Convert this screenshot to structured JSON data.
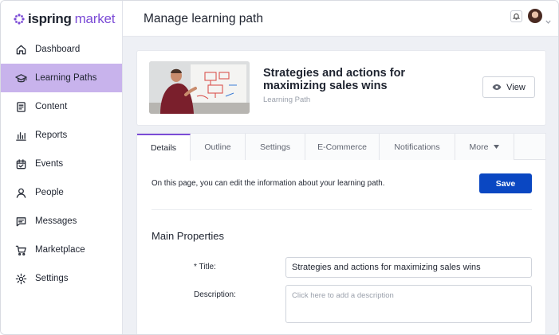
{
  "brand": {
    "name_bold": "ispring",
    "name_light": "market",
    "accent": "#7b4bd6",
    "icon": "flower-icon"
  },
  "sidebar": {
    "items": [
      {
        "label": "Dashboard",
        "icon": "home-icon",
        "active": false
      },
      {
        "label": "Learning Paths",
        "icon": "graduation-cap-icon",
        "active": true
      },
      {
        "label": "Content",
        "icon": "document-icon",
        "active": false
      },
      {
        "label": "Reports",
        "icon": "bar-chart-icon",
        "active": false
      },
      {
        "label": "Events",
        "icon": "calendar-check-icon",
        "active": false
      },
      {
        "label": "People",
        "icon": "person-icon",
        "active": false
      },
      {
        "label": "Messages",
        "icon": "message-icon",
        "active": false
      },
      {
        "label": "Marketplace",
        "icon": "cart-icon",
        "active": false
      },
      {
        "label": "Settings",
        "icon": "gear-icon",
        "active": false
      }
    ]
  },
  "header": {
    "title": "Manage learning path",
    "bell_icon": "bell-icon",
    "avatar": "user-avatar"
  },
  "course": {
    "title": "Strategies and actions for maximizing sales wins",
    "type": "Learning Path",
    "view_label": "View",
    "view_icon": "eye-icon"
  },
  "tabs": [
    {
      "label": "Details",
      "active": true
    },
    {
      "label": "Outline",
      "active": false
    },
    {
      "label": "Settings",
      "active": false
    },
    {
      "label": "E-Commerce",
      "active": false
    },
    {
      "label": "Notifications",
      "active": false
    },
    {
      "label": "More",
      "active": false
    }
  ],
  "details": {
    "intro": "On this page, you can edit the information about your learning path.",
    "save_label": "Save",
    "save_color": "#0a47c2",
    "section_title": "Main Properties",
    "title_label": "* Title:",
    "title_value": "Strategies and actions for maximizing sales wins",
    "description_label": "Description:",
    "description_placeholder": "Click here to add a description"
  }
}
